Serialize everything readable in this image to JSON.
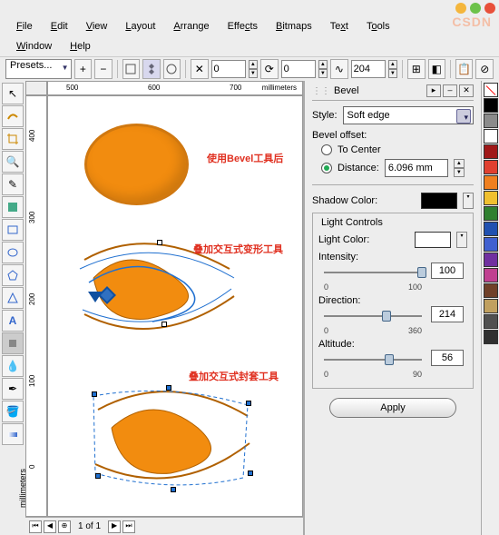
{
  "titlebar": {
    "close": "#e8503a",
    "min": "#f4b63c",
    "max": "#6cc24a"
  },
  "menu": {
    "file": "File",
    "edit": "Edit",
    "view": "View",
    "layout": "Layout",
    "arrange": "Arrange",
    "effects": "Effects",
    "bitmaps": "Bitmaps",
    "text": "Text",
    "tools": "Tools",
    "window": "Window",
    "help": "Help"
  },
  "toolbar": {
    "presets": "Presets...",
    "num1": "0",
    "num2": "0",
    "num3": "204"
  },
  "ruler": {
    "unit": "millimeters",
    "h": [
      "500",
      "600",
      "700"
    ],
    "v": [
      "400",
      "300",
      "200",
      "100",
      "0"
    ]
  },
  "annotations": {
    "a1": "使用Bevel工具后",
    "a2": "叠加交互式变形工具",
    "a3": "叠加交互式封套工具"
  },
  "pager": {
    "label": "1 of 1"
  },
  "panel": {
    "title": "Bevel",
    "style_label": "Style:",
    "style_value": "Soft edge",
    "offset_label": "Bevel offset:",
    "to_center": "To Center",
    "distance_label": "Distance:",
    "distance_value": "6.096 mm",
    "shadow_label": "Shadow Color:",
    "shadow_color": "#000000",
    "light_group": "Light Controls",
    "light_color_label": "Light Color:",
    "light_color": "#ffffff",
    "intensity_label": "Intensity:",
    "intensity_value": "100",
    "intensity_min": "0",
    "intensity_max": "100",
    "direction_label": "Direction:",
    "direction_value": "214",
    "direction_min": "0",
    "direction_max": "360",
    "altitude_label": "Altitude:",
    "altitude_value": "56",
    "altitude_min": "0",
    "altitude_max": "90",
    "apply": "Apply"
  },
  "palette": [
    "#000000",
    "#8b8b8b",
    "#ffffff",
    "#a01818",
    "#e04030",
    "#f08020",
    "#f0c030",
    "#308030",
    "#2050b0",
    "#4060d0",
    "#7030a0",
    "#c04090",
    "#704028",
    "#c0a060",
    "#505050",
    "#303030"
  ],
  "watermark": "CSDN"
}
